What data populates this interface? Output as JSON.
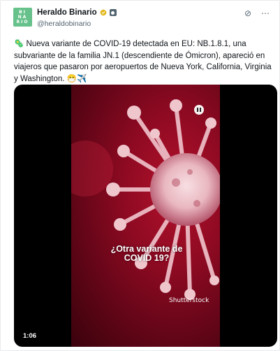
{
  "author": {
    "avatar_lines": [
      "BI",
      "NA",
      "RIO"
    ],
    "name": "Heraldo Binario",
    "handle": "@heraldobinario"
  },
  "post": {
    "emoji_lead": "🦠",
    "text": "Nueva variante de COVID-19 detectada en EU: NB.1.8.1, una subvariante de la familia JN.1 (descendiente de Ómicron), apareció en viajeros que pasaron por aeropuertos de Nueva York, California, Virginia y Washington. 😷✈️"
  },
  "video": {
    "caption_line1": "¿Otra variante de",
    "caption_line2": "COVID 19?",
    "watermark": "Shutterstock",
    "time": "1:06"
  },
  "icons": {
    "avatar": "heraldo-binario-logo",
    "verified": "gold-verified-badge",
    "org": "affiliate-badge",
    "grok": "grok-icon",
    "more": "more-options-icon",
    "pause": "pause-icon"
  },
  "colors": {
    "avatar_bg": "#67c18b",
    "verified_gold": "#e2b719",
    "virus_red": "#b3112b"
  }
}
